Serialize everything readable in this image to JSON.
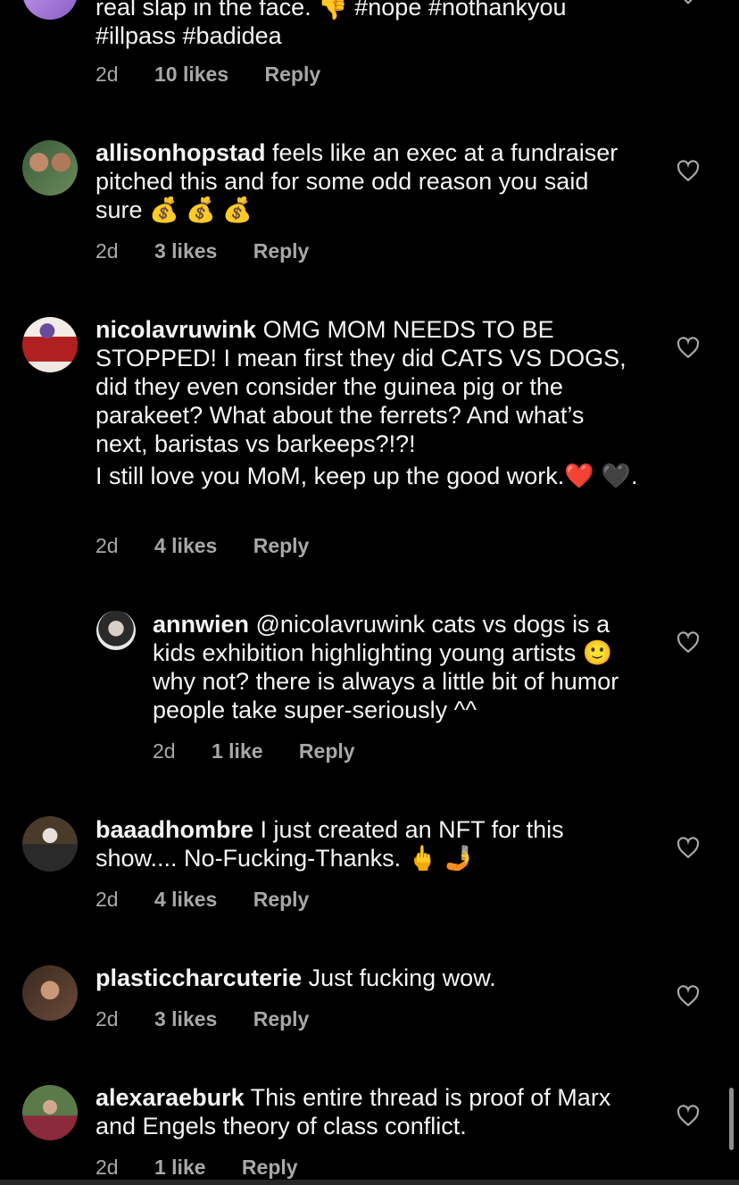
{
  "comments": [
    {
      "id": "c0",
      "username": "",
      "text_line1": "real slap in the face. 👎 #nope #nothankyou",
      "text_line2": "#illpass #badidea",
      "time": "2d",
      "likes": "10 likes",
      "reply": "Reply"
    },
    {
      "id": "c1",
      "username": "allisonhopstad",
      "text": " feels like an exec at a fundraiser pitched this and for some odd reason you said sure 💰 💰 💰",
      "time": "2d",
      "likes": "3 likes",
      "reply": "Reply"
    },
    {
      "id": "c2",
      "username": "nicolavruwink",
      "text": " OMG MOM NEEDS TO BE STOPPED! I mean first they did CATS VS DOGS, did they even consider the guinea pig or the parakeet? What about the ferrets? And what’s next, baristas vs barkeeps?!?!",
      "text2": "I still love you MoM, keep up the good work.❤️ 🖤.",
      "time": "2d",
      "likes": "4 likes",
      "reply": "Reply"
    },
    {
      "id": "c3",
      "username": "annwien",
      "text": " @nicolavruwink cats vs dogs is a kids exhibition highlighting young artists 🙂why not? there is always a little bit of humor people take super-seriously ^^",
      "time": "2d",
      "likes": "1 like",
      "reply": "Reply"
    },
    {
      "id": "c4",
      "username": "baaadhombre",
      "text": " I just created an NFT for this show.... No-Fucking-Thanks. 🖕 🤳",
      "time": "2d",
      "likes": "4 likes",
      "reply": "Reply"
    },
    {
      "id": "c5",
      "username": "plasticcharcuterie",
      "text": " Just fucking wow.",
      "time": "2d",
      "likes": "3 likes",
      "reply": "Reply"
    },
    {
      "id": "c6",
      "username": "alexaraeburk",
      "text": " This entire thread is proof of Marx and Engels theory of class conflict.",
      "time": "2d",
      "likes": "1 like",
      "reply": "Reply"
    }
  ],
  "colors": {
    "background": "#000000",
    "text": "#f5f5f5",
    "meta": "#a8a8a8"
  },
  "icons": {
    "like": "heart-icon"
  }
}
